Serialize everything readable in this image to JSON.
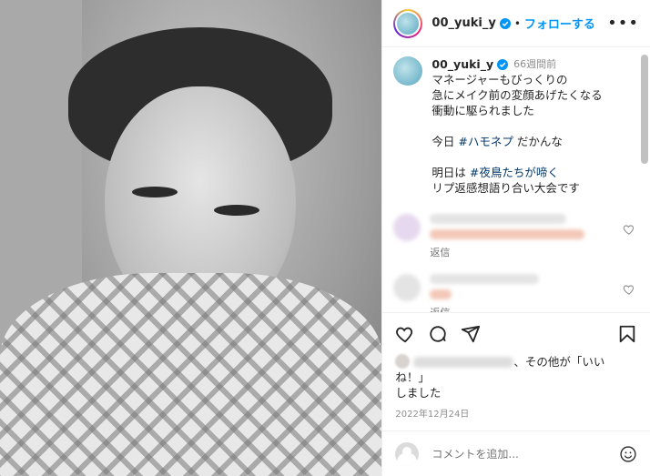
{
  "post": {
    "username": "00_yuki_y",
    "dot": "•",
    "follow_label": "フォローする",
    "more_label": "•••",
    "time_ago": "66週間前",
    "caption_lines": [
      "マネージャーもびっくりの",
      "急にメイク前の変顔あげたくなる",
      "衝動に駆られました",
      "",
      "今日 ",
      "",
      "明日は ",
      "リプ返感想語り合い大会です"
    ],
    "hashtags": {
      "today_tag": "#ハモネプ",
      "today_rest": " だかんな",
      "tomorrow_tag": "#夜鳥たちが啼く"
    },
    "comments": [
      {
        "reply_label": "返信"
      },
      {
        "reply_label": "返信"
      }
    ],
    "likes_text": "、その他が「いいね！」",
    "likes_text2": "しました",
    "likes_bold": "その他",
    "date": "2022年12月24日",
    "comment_placeholder": "コメントを追加..."
  },
  "icons": [
    "verified-badge-icon",
    "heart-icon",
    "comment-icon",
    "share-icon",
    "bookmark-icon",
    "emoji-icon",
    "more-options-icon"
  ],
  "colors": {
    "accent": "#0095f6",
    "hashtag": "#00376b",
    "muted": "#8e8e8e"
  }
}
